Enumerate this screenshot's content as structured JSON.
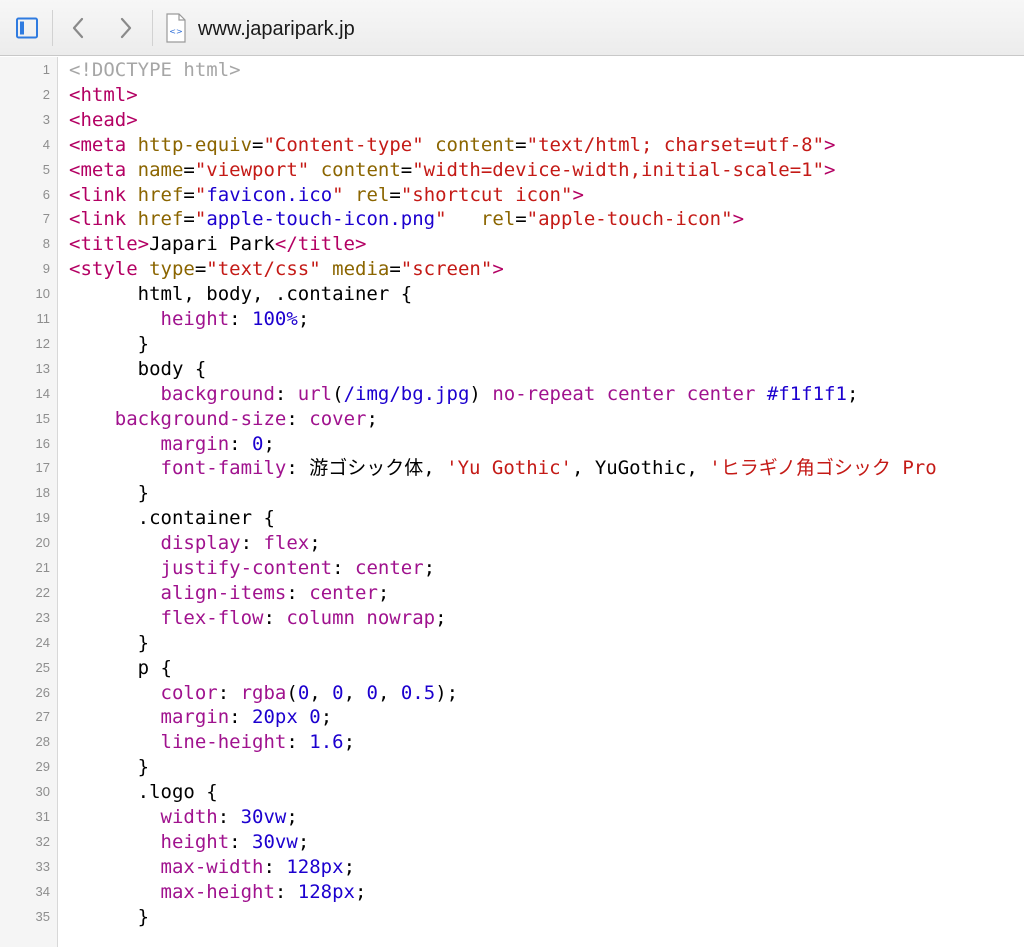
{
  "toolbar": {
    "url": "www.japaripark.jp",
    "icons": {
      "sidebar": "sidebar-toggle-icon",
      "back": "chevron-left-icon",
      "forward": "chevron-right-icon",
      "document": "html-document-icon"
    }
  },
  "colors": {
    "tag": "#b30063",
    "attr": "#8b6500",
    "string": "#c41a16",
    "property": "#a0128e",
    "value_keyword": "#a0128e",
    "number": "#1c00cf",
    "doctype": "#a6a6a6",
    "plain": "#000000",
    "url": "#1c00cf"
  },
  "source": {
    "lines": [
      {
        "n": "1",
        "tokens": [
          {
            "t": "<!DOCTYPE html>",
            "c": "doctype"
          }
        ]
      },
      {
        "n": "2",
        "tokens": [
          {
            "t": "<html>",
            "c": "tag"
          }
        ]
      },
      {
        "n": "3",
        "tokens": [
          {
            "t": "<head>",
            "c": "tag"
          }
        ]
      },
      {
        "n": "4",
        "tokens": [
          {
            "t": "<meta ",
            "c": "tag"
          },
          {
            "t": "http-equiv",
            "c": "attr"
          },
          {
            "t": "=",
            "c": "plain"
          },
          {
            "t": "\"Content-type\"",
            "c": "string"
          },
          {
            "t": " ",
            "c": "plain"
          },
          {
            "t": "content",
            "c": "attr"
          },
          {
            "t": "=",
            "c": "plain"
          },
          {
            "t": "\"text/html; charset=utf-8\"",
            "c": "string"
          },
          {
            "t": ">",
            "c": "tag"
          }
        ]
      },
      {
        "n": "5",
        "tokens": [
          {
            "t": "<meta ",
            "c": "tag"
          },
          {
            "t": "name",
            "c": "attr"
          },
          {
            "t": "=",
            "c": "plain"
          },
          {
            "t": "\"viewport\"",
            "c": "string"
          },
          {
            "t": " ",
            "c": "plain"
          },
          {
            "t": "content",
            "c": "attr"
          },
          {
            "t": "=",
            "c": "plain"
          },
          {
            "t": "\"width=device-width,initial-scale=1\"",
            "c": "string"
          },
          {
            "t": ">",
            "c": "tag"
          }
        ]
      },
      {
        "n": "6",
        "tokens": [
          {
            "t": "<link ",
            "c": "tag"
          },
          {
            "t": "href",
            "c": "attr"
          },
          {
            "t": "=",
            "c": "plain"
          },
          {
            "t": "\"",
            "c": "string"
          },
          {
            "t": "favicon.ico",
            "c": "url"
          },
          {
            "t": "\"",
            "c": "string"
          },
          {
            "t": " ",
            "c": "plain"
          },
          {
            "t": "rel",
            "c": "attr"
          },
          {
            "t": "=",
            "c": "plain"
          },
          {
            "t": "\"shortcut icon\"",
            "c": "string"
          },
          {
            "t": ">",
            "c": "tag"
          }
        ]
      },
      {
        "n": "7",
        "tokens": [
          {
            "t": "<link ",
            "c": "tag"
          },
          {
            "t": "href",
            "c": "attr"
          },
          {
            "t": "=",
            "c": "plain"
          },
          {
            "t": "\"",
            "c": "string"
          },
          {
            "t": "apple-touch-icon.png",
            "c": "url"
          },
          {
            "t": "\"",
            "c": "string"
          },
          {
            "t": "   ",
            "c": "plain"
          },
          {
            "t": "rel",
            "c": "attr"
          },
          {
            "t": "=",
            "c": "plain"
          },
          {
            "t": "\"apple-touch-icon\"",
            "c": "string"
          },
          {
            "t": ">",
            "c": "tag"
          }
        ]
      },
      {
        "n": "8",
        "tokens": [
          {
            "t": "<title>",
            "c": "tag"
          },
          {
            "t": "Japari Park",
            "c": "plain"
          },
          {
            "t": "</title>",
            "c": "tag"
          }
        ]
      },
      {
        "n": "9",
        "tokens": [
          {
            "t": "<style ",
            "c": "tag"
          },
          {
            "t": "type",
            "c": "attr"
          },
          {
            "t": "=",
            "c": "plain"
          },
          {
            "t": "\"text/css\"",
            "c": "string"
          },
          {
            "t": " ",
            "c": "plain"
          },
          {
            "t": "media",
            "c": "attr"
          },
          {
            "t": "=",
            "c": "plain"
          },
          {
            "t": "\"screen\"",
            "c": "string"
          },
          {
            "t": ">",
            "c": "tag"
          }
        ]
      },
      {
        "n": "10",
        "tokens": [
          {
            "t": "      html, body, .container {",
            "c": "plain"
          }
        ]
      },
      {
        "n": "11",
        "tokens": [
          {
            "t": "        ",
            "c": "plain"
          },
          {
            "t": "height",
            "c": "property"
          },
          {
            "t": ": ",
            "c": "plain"
          },
          {
            "t": "100%",
            "c": "number"
          },
          {
            "t": ";",
            "c": "plain"
          }
        ]
      },
      {
        "n": "12",
        "tokens": [
          {
            "t": "      }",
            "c": "plain"
          }
        ]
      },
      {
        "n": "13",
        "tokens": [
          {
            "t": "      body {",
            "c": "plain"
          }
        ]
      },
      {
        "n": "14",
        "tokens": [
          {
            "t": "        ",
            "c": "plain"
          },
          {
            "t": "background",
            "c": "property"
          },
          {
            "t": ": ",
            "c": "plain"
          },
          {
            "t": "url",
            "c": "value_keyword"
          },
          {
            "t": "(",
            "c": "plain"
          },
          {
            "t": "/img/bg.jpg",
            "c": "url"
          },
          {
            "t": ") ",
            "c": "plain"
          },
          {
            "t": "no-repeat center center ",
            "c": "value_keyword"
          },
          {
            "t": "#f1f1f1",
            "c": "number"
          },
          {
            "t": ";",
            "c": "plain"
          }
        ]
      },
      {
        "n": "15",
        "tokens": [
          {
            "t": "    ",
            "c": "plain"
          },
          {
            "t": "background-size",
            "c": "property"
          },
          {
            "t": ": ",
            "c": "plain"
          },
          {
            "t": "cover",
            "c": "value_keyword"
          },
          {
            "t": ";",
            "c": "plain"
          }
        ]
      },
      {
        "n": "16",
        "tokens": [
          {
            "t": "        ",
            "c": "plain"
          },
          {
            "t": "margin",
            "c": "property"
          },
          {
            "t": ": ",
            "c": "plain"
          },
          {
            "t": "0",
            "c": "number"
          },
          {
            "t": ";",
            "c": "plain"
          }
        ]
      },
      {
        "n": "17",
        "tokens": [
          {
            "t": "        ",
            "c": "plain"
          },
          {
            "t": "font-family",
            "c": "property"
          },
          {
            "t": ": 游ゴシック体, ",
            "c": "plain"
          },
          {
            "t": "'Yu Gothic'",
            "c": "string"
          },
          {
            "t": ", YuGothic, ",
            "c": "plain"
          },
          {
            "t": "'ヒラギノ角ゴシック Pro",
            "c": "string"
          }
        ]
      },
      {
        "n": "18",
        "tokens": [
          {
            "t": "      }",
            "c": "plain"
          }
        ]
      },
      {
        "n": "19",
        "tokens": [
          {
            "t": "      .container {",
            "c": "plain"
          }
        ]
      },
      {
        "n": "20",
        "tokens": [
          {
            "t": "        ",
            "c": "plain"
          },
          {
            "t": "display",
            "c": "property"
          },
          {
            "t": ": ",
            "c": "plain"
          },
          {
            "t": "flex",
            "c": "value_keyword"
          },
          {
            "t": ";",
            "c": "plain"
          }
        ]
      },
      {
        "n": "21",
        "tokens": [
          {
            "t": "        ",
            "c": "plain"
          },
          {
            "t": "justify-content",
            "c": "property"
          },
          {
            "t": ": ",
            "c": "plain"
          },
          {
            "t": "center",
            "c": "value_keyword"
          },
          {
            "t": ";",
            "c": "plain"
          }
        ]
      },
      {
        "n": "22",
        "tokens": [
          {
            "t": "        ",
            "c": "plain"
          },
          {
            "t": "align-items",
            "c": "property"
          },
          {
            "t": ": ",
            "c": "plain"
          },
          {
            "t": "center",
            "c": "value_keyword"
          },
          {
            "t": ";",
            "c": "plain"
          }
        ]
      },
      {
        "n": "23",
        "tokens": [
          {
            "t": "        ",
            "c": "plain"
          },
          {
            "t": "flex-flow",
            "c": "property"
          },
          {
            "t": ": ",
            "c": "plain"
          },
          {
            "t": "column nowrap",
            "c": "value_keyword"
          },
          {
            "t": ";",
            "c": "plain"
          }
        ]
      },
      {
        "n": "24",
        "tokens": [
          {
            "t": "      }",
            "c": "plain"
          }
        ]
      },
      {
        "n": "25",
        "tokens": [
          {
            "t": "      p {",
            "c": "plain"
          }
        ]
      },
      {
        "n": "26",
        "tokens": [
          {
            "t": "        ",
            "c": "plain"
          },
          {
            "t": "color",
            "c": "property"
          },
          {
            "t": ": ",
            "c": "plain"
          },
          {
            "t": "rgba",
            "c": "value_keyword"
          },
          {
            "t": "(",
            "c": "plain"
          },
          {
            "t": "0",
            "c": "number"
          },
          {
            "t": ", ",
            "c": "plain"
          },
          {
            "t": "0",
            "c": "number"
          },
          {
            "t": ", ",
            "c": "plain"
          },
          {
            "t": "0",
            "c": "number"
          },
          {
            "t": ", ",
            "c": "plain"
          },
          {
            "t": "0.5",
            "c": "number"
          },
          {
            "t": ");",
            "c": "plain"
          }
        ]
      },
      {
        "n": "27",
        "tokens": [
          {
            "t": "        ",
            "c": "plain"
          },
          {
            "t": "margin",
            "c": "property"
          },
          {
            "t": ": ",
            "c": "plain"
          },
          {
            "t": "20px",
            "c": "number"
          },
          {
            "t": " ",
            "c": "plain"
          },
          {
            "t": "0",
            "c": "number"
          },
          {
            "t": ";",
            "c": "plain"
          }
        ]
      },
      {
        "n": "28",
        "tokens": [
          {
            "t": "        ",
            "c": "plain"
          },
          {
            "t": "line-height",
            "c": "property"
          },
          {
            "t": ": ",
            "c": "plain"
          },
          {
            "t": "1.6",
            "c": "number"
          },
          {
            "t": ";",
            "c": "plain"
          }
        ]
      },
      {
        "n": "29",
        "tokens": [
          {
            "t": "      }",
            "c": "plain"
          }
        ]
      },
      {
        "n": "30",
        "tokens": [
          {
            "t": "      .logo {",
            "c": "plain"
          }
        ]
      },
      {
        "n": "31",
        "tokens": [
          {
            "t": "        ",
            "c": "plain"
          },
          {
            "t": "width",
            "c": "property"
          },
          {
            "t": ": ",
            "c": "plain"
          },
          {
            "t": "30vw",
            "c": "number"
          },
          {
            "t": ";",
            "c": "plain"
          }
        ]
      },
      {
        "n": "32",
        "tokens": [
          {
            "t": "        ",
            "c": "plain"
          },
          {
            "t": "height",
            "c": "property"
          },
          {
            "t": ": ",
            "c": "plain"
          },
          {
            "t": "30vw",
            "c": "number"
          },
          {
            "t": ";",
            "c": "plain"
          }
        ]
      },
      {
        "n": "33",
        "tokens": [
          {
            "t": "        ",
            "c": "plain"
          },
          {
            "t": "max-width",
            "c": "property"
          },
          {
            "t": ": ",
            "c": "plain"
          },
          {
            "t": "128px",
            "c": "number"
          },
          {
            "t": ";",
            "c": "plain"
          }
        ]
      },
      {
        "n": "34",
        "tokens": [
          {
            "t": "        ",
            "c": "plain"
          },
          {
            "t": "max-height",
            "c": "property"
          },
          {
            "t": ": ",
            "c": "plain"
          },
          {
            "t": "128px",
            "c": "number"
          },
          {
            "t": ";",
            "c": "plain"
          }
        ]
      },
      {
        "n": "35",
        "tokens": [
          {
            "t": "      }",
            "c": "plain"
          }
        ]
      }
    ]
  }
}
